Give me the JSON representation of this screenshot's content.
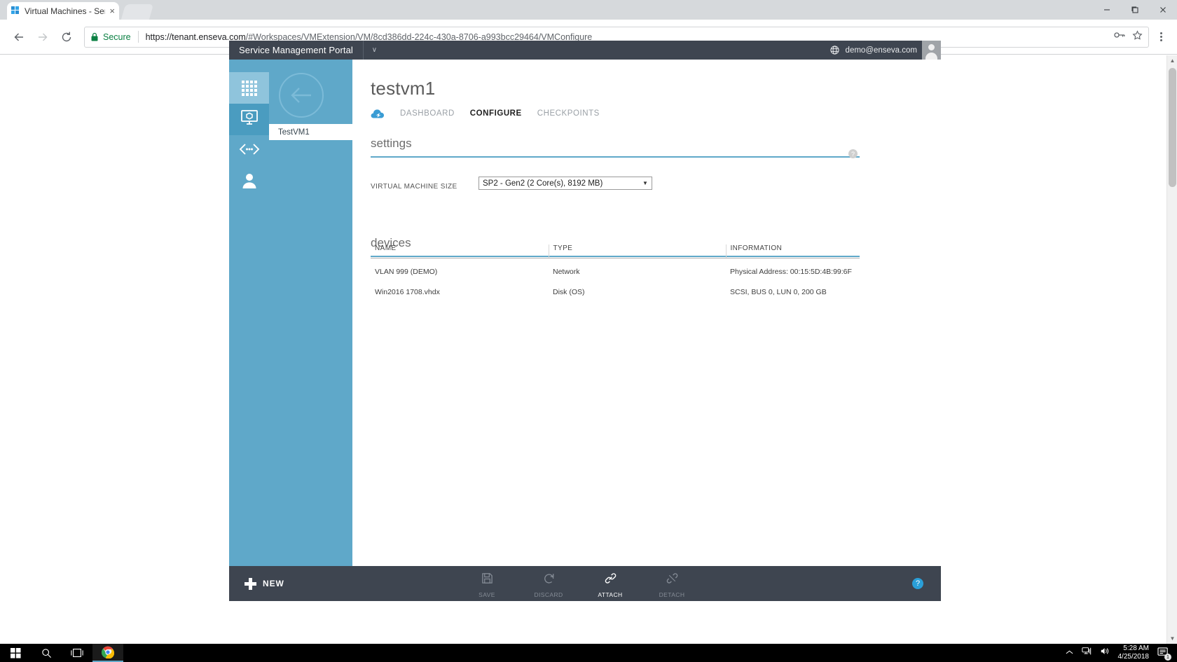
{
  "browser": {
    "tab": {
      "title": "Virtual Machines - Servic",
      "close_label": "×",
      "favicon": "windows-logo-icon"
    },
    "new_tab_label": "",
    "window_controls": {
      "minimize": "minimize-icon",
      "maximize": "maximize-icon",
      "close": "close-icon"
    },
    "nav": {
      "back": "back-arrow-icon",
      "forward": "forward-arrow-icon",
      "reload": "reload-icon",
      "profile": "profile-icon"
    },
    "omnibox": {
      "security_label": "Secure",
      "url_host": "https://tenant.enseva.com",
      "url_path": "/#Workspaces/VMExtension/VM/8cd386dd-224c-430a-8706-a993bcc29464/VMConfigure",
      "key_icon": "key-icon",
      "bookmark_icon": "star-icon",
      "menu_icon": "three-dot-menu-icon"
    }
  },
  "portal": {
    "brand": "Service Management Portal",
    "chevron": "∨",
    "user_email": "demo@enseva.com",
    "globe_icon": "globe-icon",
    "avatar": "user-avatar",
    "rail": [
      {
        "name": "all-items",
        "icon": "grid-icon",
        "state": "highlight"
      },
      {
        "name": "virtual-machines",
        "icon": "vm-monitor-icon",
        "state": "active"
      },
      {
        "name": "networks",
        "icon": "network-icon",
        "state": "normal"
      },
      {
        "name": "user-accounts",
        "icon": "person-icon",
        "state": "normal"
      }
    ],
    "vm_list": [
      {
        "label": "TestVM1",
        "selected": true
      }
    ],
    "back_button": "back-arrow-circle",
    "page_title": "testvm1",
    "tabs": [
      {
        "label": "DASHBOARD",
        "active": false
      },
      {
        "label": "CONFIGURE",
        "active": true
      },
      {
        "label": "CHECKPOINTS",
        "active": false
      }
    ],
    "settings": {
      "heading": "settings",
      "help_glyph": "?",
      "field_label": "VIRTUAL MACHINE SIZE",
      "selected_size": "SP2 - Gen2 (2 Core(s), 8192 MB)",
      "caret": "▼"
    },
    "devices": {
      "heading": "devices",
      "columns": [
        "NAME",
        "TYPE",
        "INFORMATION"
      ],
      "rows": [
        {
          "name": "VLAN 999 (DEMO)",
          "type": "Network",
          "information": "Physical Address: 00:15:5D:4B:99:6F"
        },
        {
          "name": "Win2016 1708.vhdx",
          "type": "Disk (OS)",
          "information": "SCSI, BUS 0, LUN 0, 200 GB"
        }
      ]
    },
    "commandbar": {
      "new_label": "NEW",
      "commands": [
        {
          "label": "SAVE",
          "icon": "save-icon",
          "enabled": false
        },
        {
          "label": "DISCARD",
          "icon": "discard-undo-icon",
          "enabled": false
        },
        {
          "label": "ATTACH",
          "icon": "link-attach-icon",
          "enabled": true
        },
        {
          "label": "DETACH",
          "icon": "broken-link-detach-icon",
          "enabled": false
        }
      ],
      "help_label": "?"
    }
  },
  "taskbar": {
    "start": "windows-start-icon",
    "search": "search-icon",
    "taskview": "task-view-icon",
    "chrome": "chrome-icon",
    "tray": {
      "chevron": "show-hidden-icons",
      "network": "network-tray-icon",
      "volume": "volume-icon"
    },
    "time": "5:28 AM",
    "date": "4/25/2018",
    "notification_count": "1"
  },
  "colors": {
    "accent_blue": "#5fa8c9",
    "dark_chrome": "#3e4550",
    "secure_green": "#0b8043",
    "help_blue": "#2a9fd8"
  }
}
